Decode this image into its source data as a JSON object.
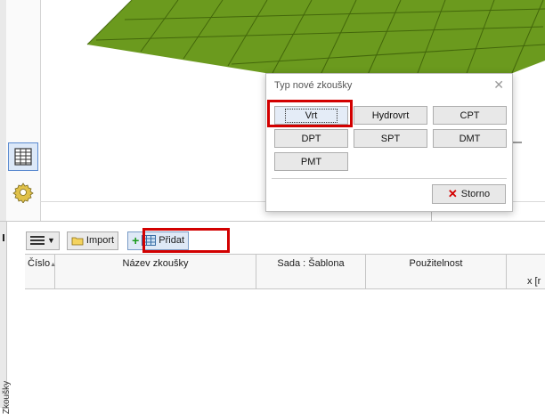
{
  "dialog": {
    "title": "Typ nové zkoušky",
    "close_glyph": "✕",
    "buttons": [
      "Vrt",
      "Hydrovrt",
      "CPT",
      "DPT",
      "SPT",
      "DMT",
      "PMT"
    ],
    "cancel_label": "Storno",
    "highlight_color": "#d20000"
  },
  "toolbar": {
    "list_icon": "list-icon",
    "import_label": "Import",
    "add_label": "Přidat"
  },
  "table": {
    "columns": [
      "Číslo",
      "Název zkoušky",
      "Sada : Šablona",
      "Použitelnost",
      "x [r"
    ]
  },
  "side_panel": {
    "vertical_label": "Zkoušky"
  },
  "colors": {
    "terrain": "#6b9a1e",
    "terrain_grid": "#3d5f08"
  }
}
